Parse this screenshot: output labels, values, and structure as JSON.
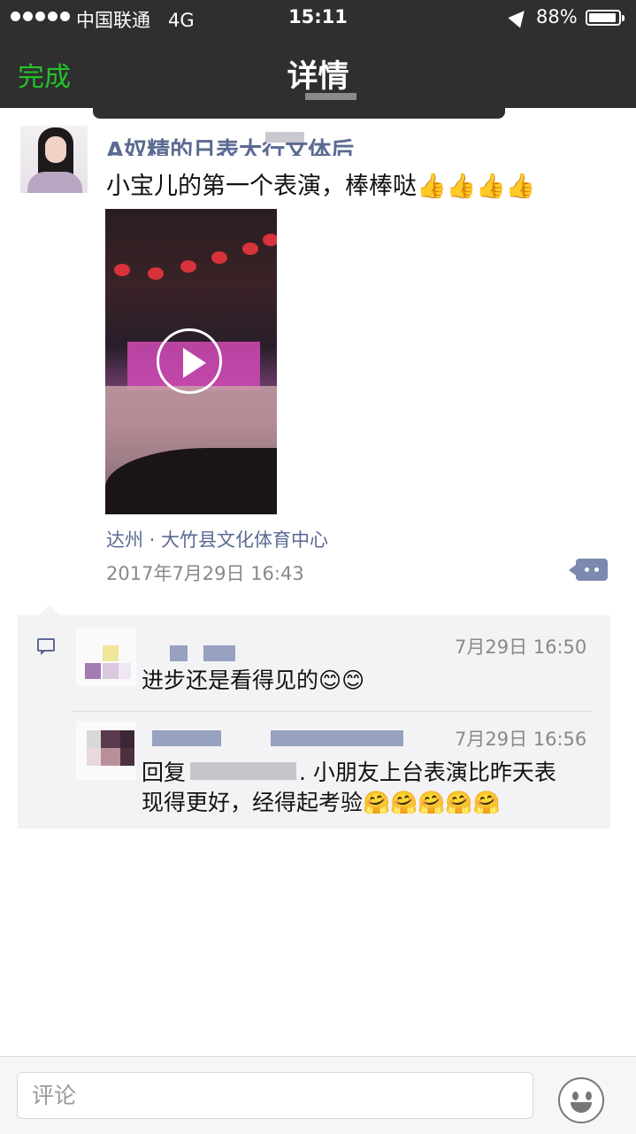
{
  "status_bar": {
    "carrier": "中国联通",
    "network": "4G",
    "time": "15:11",
    "battery_percent": "88%",
    "battery_level": 0.88
  },
  "nav": {
    "done_label": "完成",
    "title": "详情",
    "accent_color": "#22c22a"
  },
  "post": {
    "author_visible": "A奴精的日表大行文体后",
    "text": "小宝儿的第一个表演，棒棒哒👍👍👍👍",
    "location": "达州 · 大竹县文化体育中心",
    "timestamp": "2017年7月29日 16:43",
    "link_color": "#5b6a92"
  },
  "comments": [
    {
      "time": "7月29日 16:50",
      "text": "进步还是看得见的😊😊"
    },
    {
      "time": "7月29日 16:56",
      "reply_prefix": "回复",
      "text_line1": ". 小朋友上台表演比昨天表",
      "text_line2": "现得更好，经得起考验🤗🤗🤗🤗🤗"
    }
  ],
  "input": {
    "placeholder": "评论"
  },
  "icons": [
    "play-icon",
    "more-icon",
    "comment-icon",
    "emoji-icon",
    "location-arrow-icon",
    "battery-icon"
  ]
}
